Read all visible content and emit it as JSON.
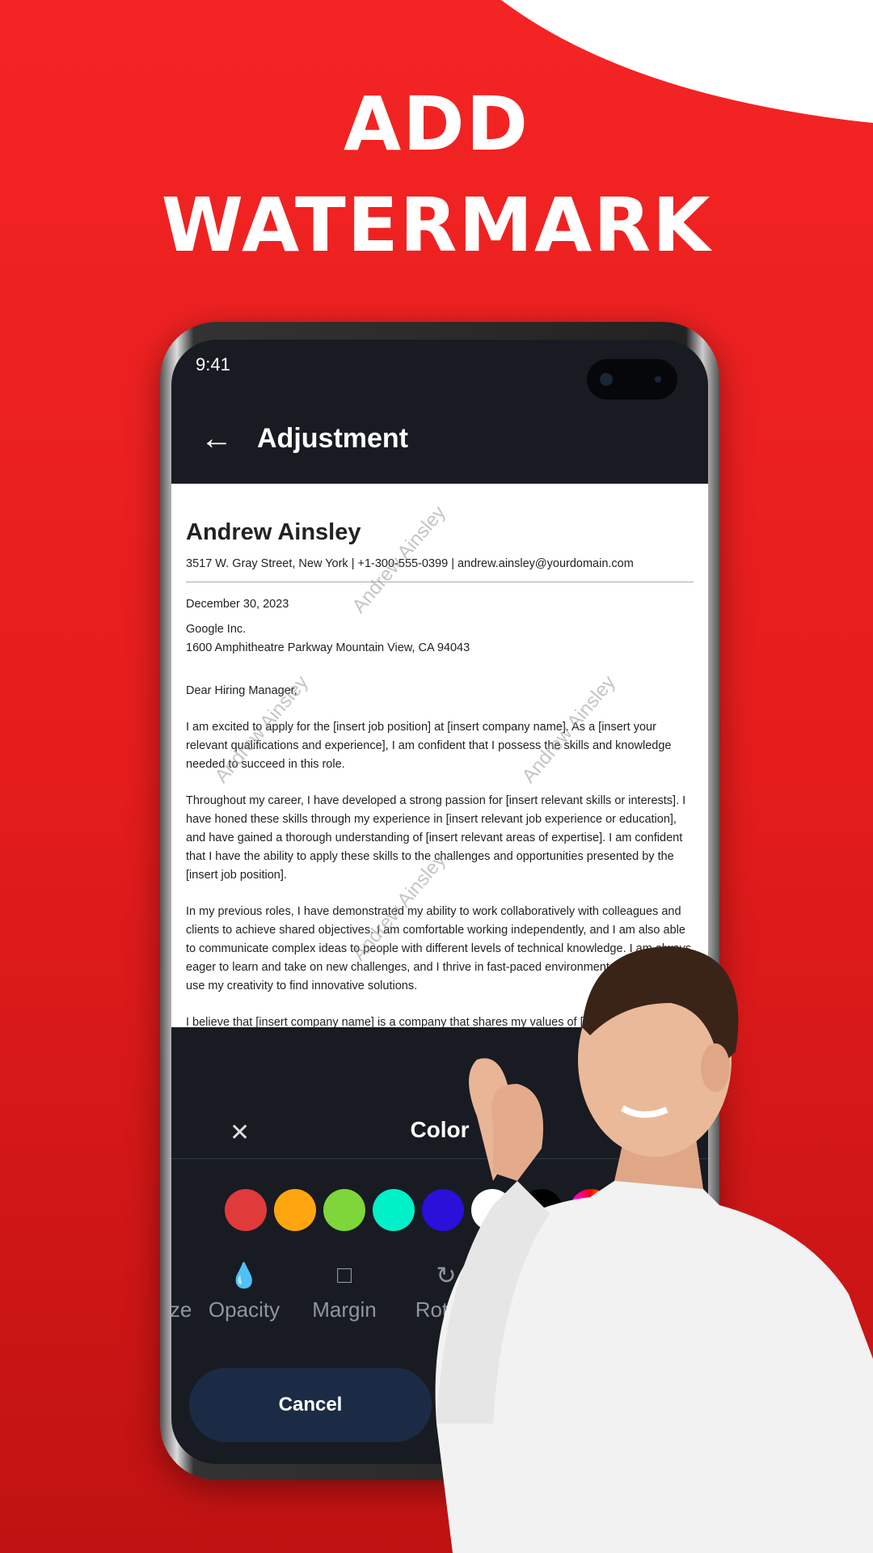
{
  "headline": {
    "line1": "ADD",
    "line2": "WATERMARK"
  },
  "status": {
    "time": "9:41"
  },
  "header": {
    "back_icon": "arrow-left-icon",
    "title": "Adjustment"
  },
  "document": {
    "name": "Andrew Ainsley",
    "contact": "3517 W. Gray Street, New York | +1-300-555-0399 | andrew.ainsley@yourdomain.com",
    "date": "December 30, 2023",
    "company": "Google Inc.",
    "address": "1600 Amphitheatre Parkway Mountain View, CA 94043",
    "greeting": "Dear Hiring Manager,",
    "paragraphs": [
      "I am excited to apply for the [insert job position] at [insert company name]. As a [insert your relevant qualifications and experience], I am confident that I possess the skills and knowledge needed to succeed in this role.",
      "Throughout my career, I have developed a strong passion for [insert relevant skills or interests]. I have honed these skills through my experience in [insert relevant job experience or education], and have gained a thorough understanding of [insert relevant areas of expertise]. I am confident that I have the ability to apply these skills to the challenges and opportunities presented by the [insert job position].",
      "In my previous roles, I have demonstrated my ability to work collaboratively with colleagues and clients to achieve shared objectives. I am comfortable working independently, and I am also able to communicate complex ideas to people with different levels of technical knowledge. I am always eager to learn and take on new challenges, and I thrive in fast-paced environments where I can use my creativity to find innovative solutions.",
      "I believe that [insert company name] is a company that shares my values of [insert"
    ],
    "watermark": "Andrew Ainsley"
  },
  "panel": {
    "title": "Color",
    "close_icon": "close-icon",
    "swatches": [
      "#e03a3a",
      "#ffa50f",
      "#7ed63a",
      "#00f0c8",
      "#2a10d8",
      "#ffffff",
      "#000000",
      "gradient"
    ],
    "tools": [
      {
        "label": "Size"
      },
      {
        "label": "Opacity",
        "icon": "opacity-drop-icon"
      },
      {
        "label": "Margin",
        "icon": "margin-icon"
      },
      {
        "label": "Rotate",
        "icon": "rotate-icon"
      }
    ],
    "cancel": "Cancel"
  },
  "colors": {
    "background": "#e41c1c",
    "screen": "#181b22",
    "cancel_button": "#1c2b45"
  }
}
